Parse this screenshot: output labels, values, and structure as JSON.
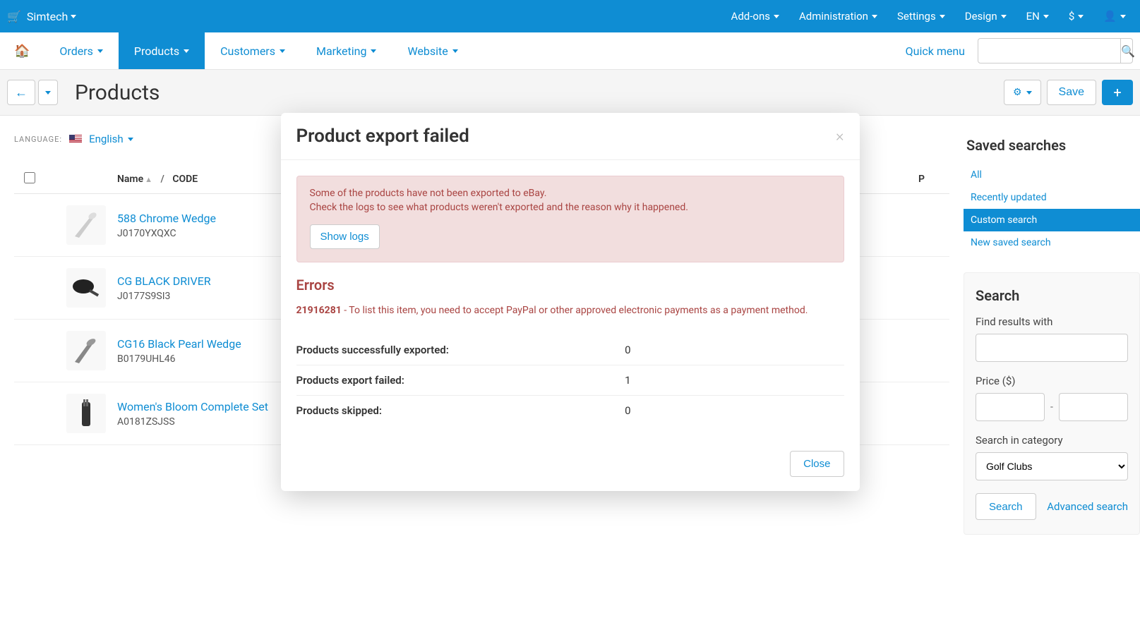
{
  "topbar": {
    "brand": "Simtech",
    "items": [
      "Add-ons",
      "Administration",
      "Settings",
      "Design",
      "EN",
      "$"
    ]
  },
  "nav": {
    "items": [
      "Orders",
      "Products",
      "Customers",
      "Marketing",
      "Website"
    ],
    "quick_menu": "Quick menu"
  },
  "page": {
    "title": "Products",
    "save": "Save"
  },
  "language": {
    "label": "LANGUAGE:",
    "current": "English"
  },
  "table": {
    "name_label": "Name",
    "code_label": "CODE",
    "p_col": "P"
  },
  "products": [
    {
      "name": "588 Chrome Wedge",
      "code": "J0170YXQXC"
    },
    {
      "name": "CG BLACK DRIVER",
      "code": "J0177S9SI3"
    },
    {
      "name": "CG16 Black Pearl Wedge",
      "code": "B0179UHL46"
    },
    {
      "name": "Women's Bloom Complete Set",
      "code": "A0181ZSJSS"
    }
  ],
  "sidebar": {
    "saved_title": "Saved searches",
    "saved": [
      "All",
      "Recently updated",
      "Custom search",
      "New saved search"
    ],
    "search_title": "Search",
    "find_label": "Find results with",
    "price_label": "Price ($)",
    "cat_label": "Search in category",
    "cat_value": "Golf Clubs",
    "search_btn": "Search",
    "adv": "Advanced search"
  },
  "modal": {
    "title": "Product export failed",
    "alert_line1": "Some of the products have not been exported to eBay.",
    "alert_line2": "Check the logs to see what products weren't exported and the reason why it happened.",
    "show_logs": "Show logs",
    "errors_heading": "Errors",
    "error_code": "21916281",
    "error_msg": " - To list this item, you need to accept PayPal or other approved electronic payments as a payment method.",
    "stats": [
      {
        "label": "Products successfully exported:",
        "value": "0"
      },
      {
        "label": "Products export failed:",
        "value": "1"
      },
      {
        "label": "Products skipped:",
        "value": "0"
      }
    ],
    "close": "Close"
  }
}
